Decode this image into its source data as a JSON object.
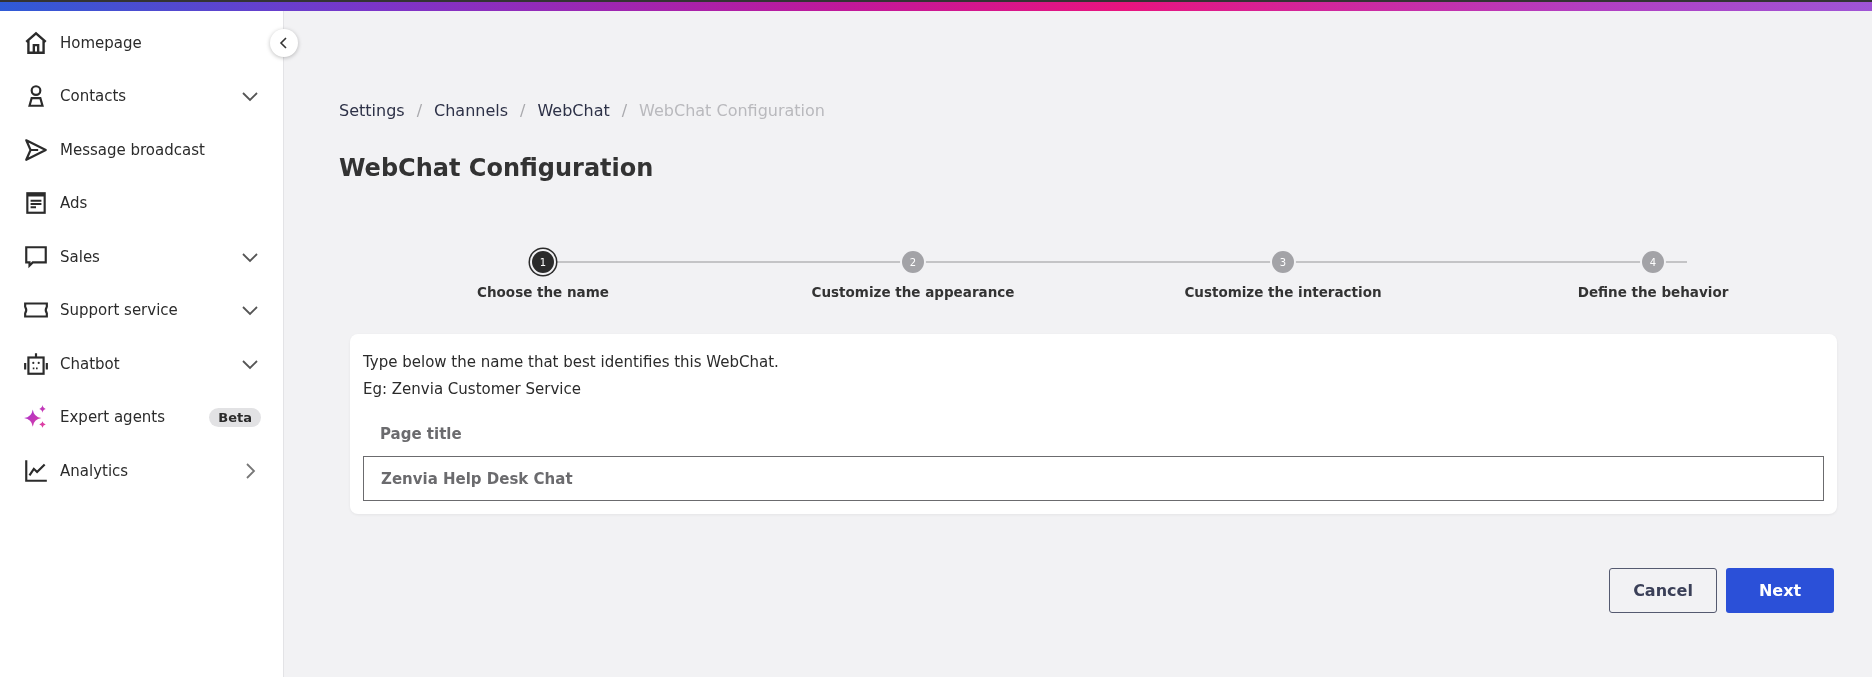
{
  "sidebar": {
    "items": [
      {
        "label": "Homepage",
        "kind": "link"
      },
      {
        "label": "Contacts",
        "kind": "group"
      },
      {
        "label": "Message broadcast",
        "kind": "link"
      },
      {
        "label": "Ads",
        "kind": "link"
      },
      {
        "label": "Sales",
        "kind": "group"
      },
      {
        "label": "Support service",
        "kind": "group"
      },
      {
        "label": "Chatbot",
        "kind": "group"
      },
      {
        "label": "Expert agents",
        "kind": "link",
        "badge": "Beta"
      },
      {
        "label": "Analytics",
        "kind": "section"
      }
    ]
  },
  "breadcrumb": [
    {
      "label": "Settings",
      "current": false
    },
    {
      "label": "Channels",
      "current": false
    },
    {
      "label": "WebChat",
      "current": false
    },
    {
      "label": "WebChat Configuration",
      "current": true
    }
  ],
  "breadcrumb_separator": "/",
  "page_title": "WebChat Configuration",
  "stepper": [
    {
      "number": "1",
      "label": "Choose the name",
      "selected": true
    },
    {
      "number": "2",
      "label": "Customize the appearance",
      "selected": false
    },
    {
      "number": "3",
      "label": "Customize the interaction",
      "selected": false
    },
    {
      "number": "4",
      "label": "Define the behavior",
      "selected": false
    }
  ],
  "card": {
    "instruction": "Type below the name that best identifies this WebChat.",
    "example": "Eg: Zenvia Customer Service",
    "field_label": "Page title",
    "field_value": "Zenvia Help Desk Chat"
  },
  "buttons": {
    "cancel": "Cancel",
    "next": "Next"
  }
}
